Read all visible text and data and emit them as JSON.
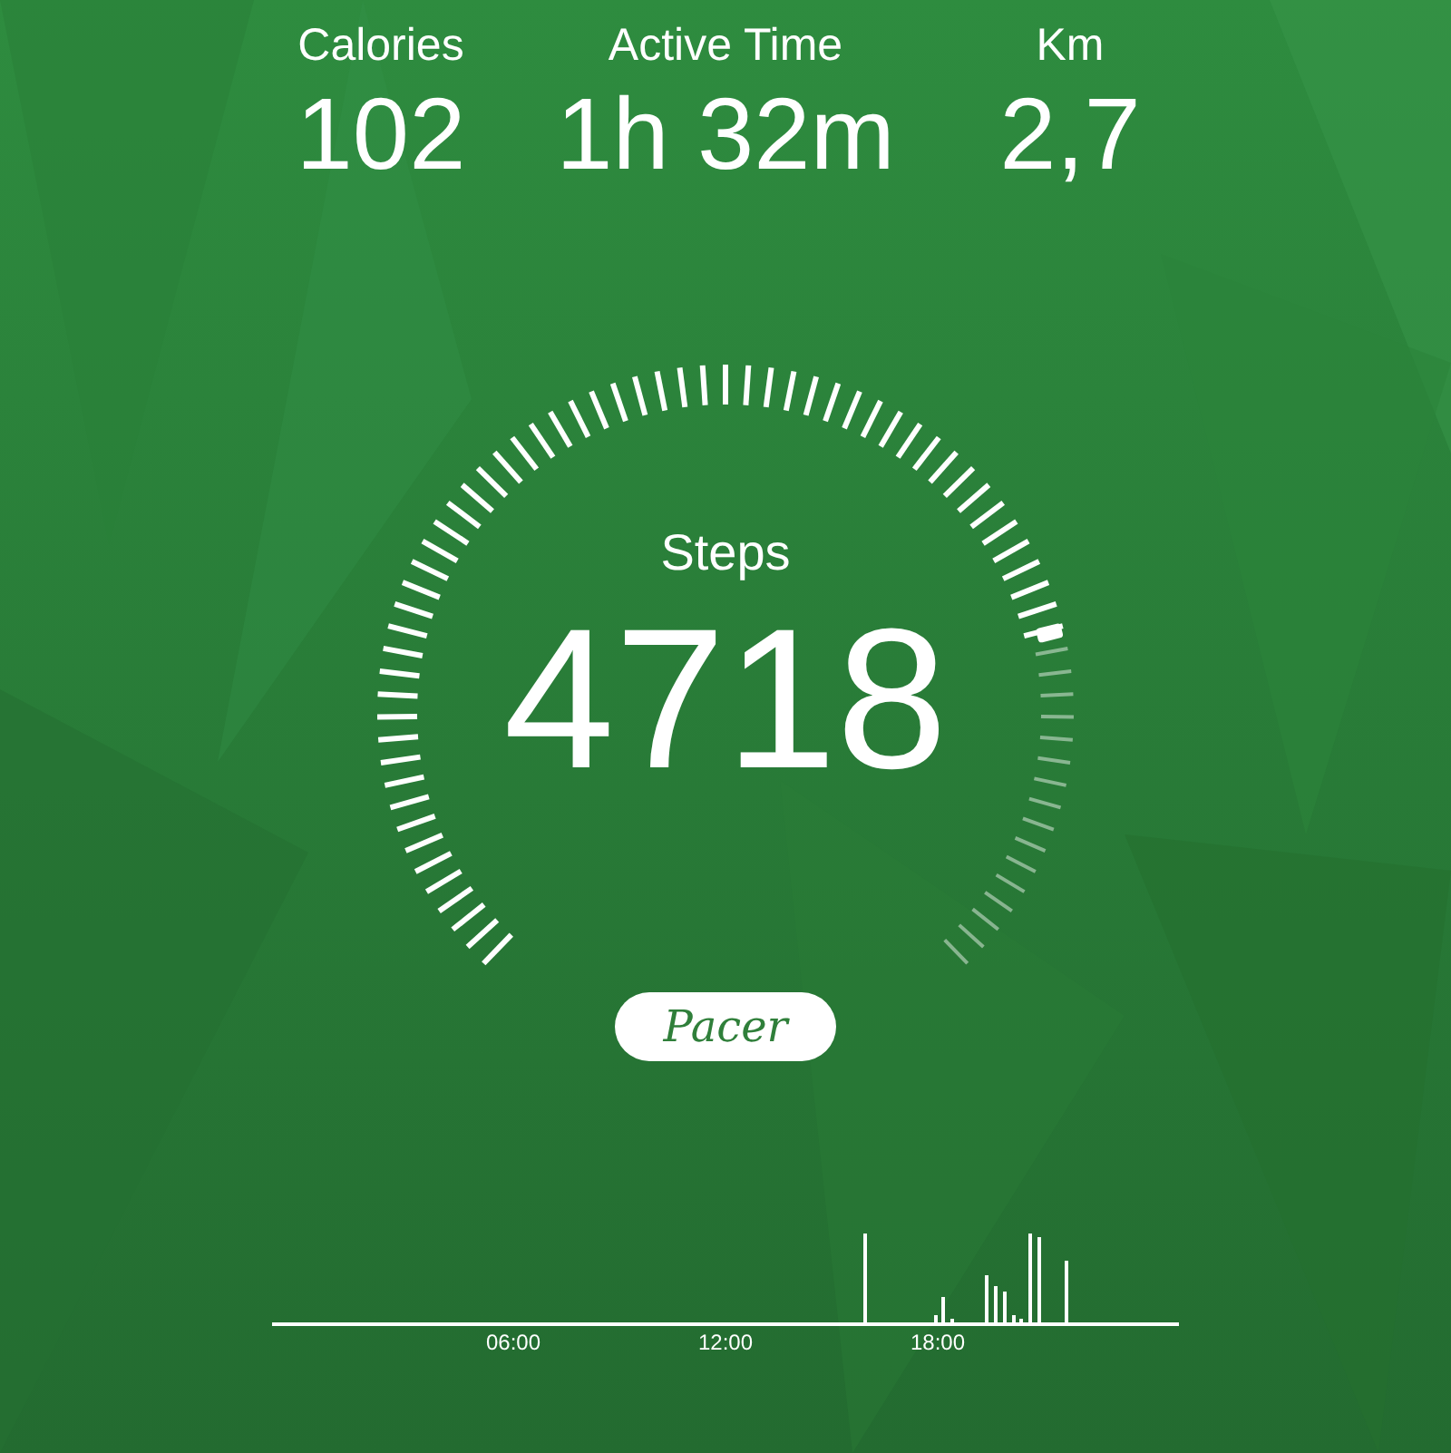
{
  "stats": [
    {
      "label": "Calories",
      "value": "102"
    },
    {
      "label": "Active Time",
      "value": "1h 32m"
    },
    {
      "label": "Km",
      "value": "2,7"
    }
  ],
  "steps": {
    "label": "Steps",
    "value": "4718"
  },
  "badge": "Pacer",
  "activity_chart": {
    "axis_labels": [
      "06:00",
      "12:00",
      "18:00"
    ]
  }
}
